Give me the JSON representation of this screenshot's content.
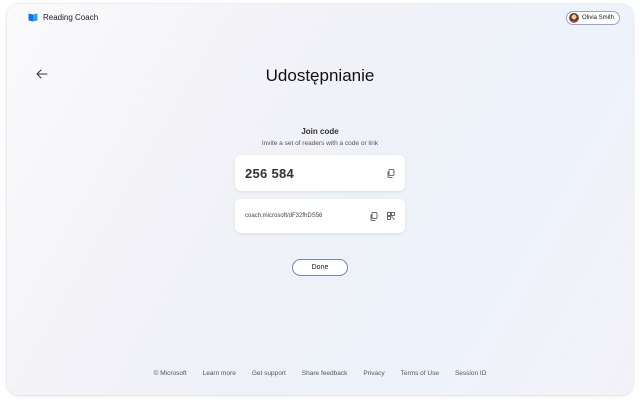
{
  "app": {
    "name": "Reading Coach"
  },
  "user": {
    "name": "Olivia Smith"
  },
  "page": {
    "title": "Udostępnianie",
    "section_title": "Join code",
    "section_subtitle": "Invite a set of readers with a code or link"
  },
  "join": {
    "code": "256 584",
    "link": "coach.microsoft/dF32fhDS56"
  },
  "actions": {
    "done_label": "Done"
  },
  "footer": {
    "links": [
      "© Microsoft",
      "Learn more",
      "Get support",
      "Share feedback",
      "Privacy",
      "Terms of Use",
      "Session ID"
    ]
  },
  "colors": {
    "accent_outline": "#7a86b8",
    "logo_blue": "#1a73d9"
  }
}
